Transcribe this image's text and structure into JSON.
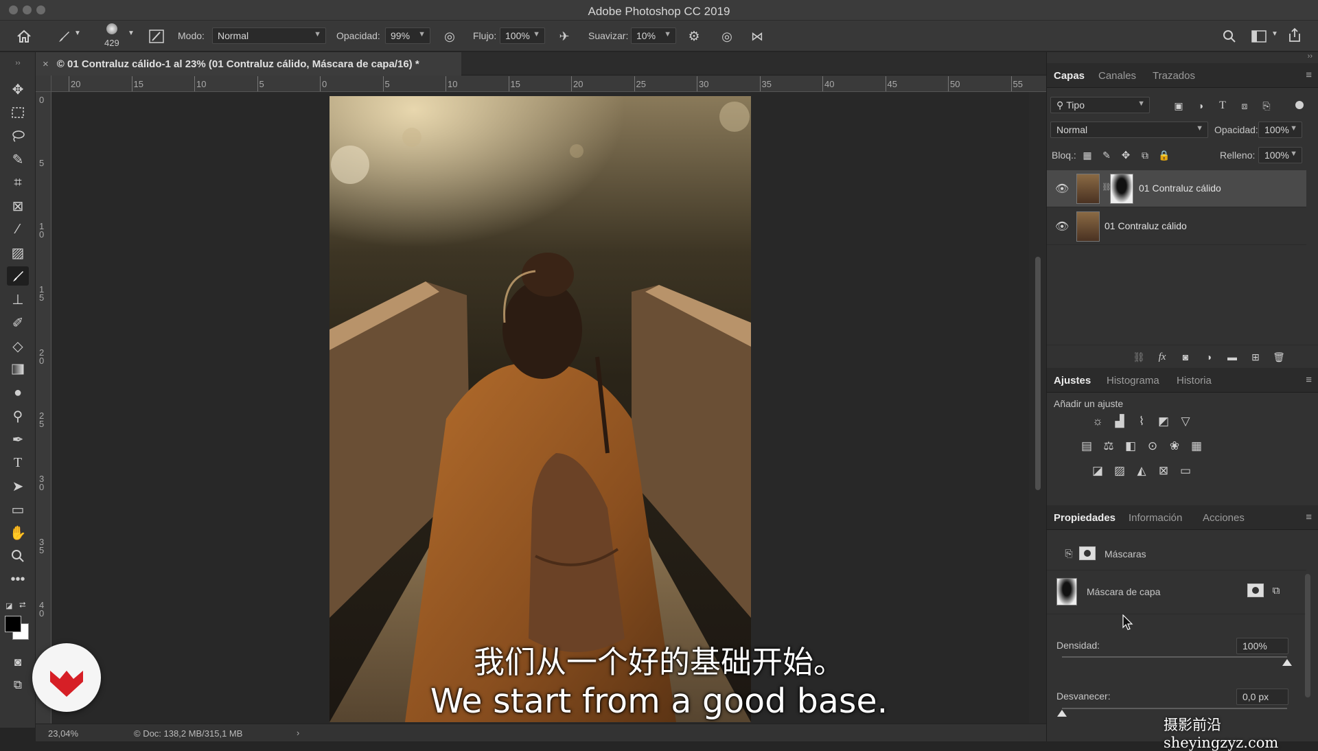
{
  "window": {
    "title": "Adobe Photoshop CC 2019"
  },
  "options_bar": {
    "brush_size": "429",
    "mode_label": "Modo:",
    "mode_value": "Normal",
    "opacity_label": "Opacidad:",
    "opacity_value": "99%",
    "flow_label": "Flujo:",
    "flow_value": "100%",
    "smoothing_label": "Suavizar:",
    "smoothing_value": "10%"
  },
  "document": {
    "tab_title": "© 01 Contraluz cálido-1 al 23% (01 Contraluz cálido, Máscara de capa/16) *",
    "ruler_h_ticks": [
      "20",
      "15",
      "10",
      "5",
      "0",
      "5",
      "10",
      "15",
      "20",
      "25",
      "30",
      "35",
      "40",
      "45",
      "50",
      "55"
    ],
    "ruler_v_ticks": [
      "0",
      "5",
      "1 0",
      "1 5",
      "2 0",
      "2 5",
      "3 0",
      "3 5",
      "4 0",
      "5"
    ]
  },
  "status_bar": {
    "zoom": "23,04%",
    "doc_info": "© Doc: 138,2 MB/315,1 MB"
  },
  "layers_panel": {
    "tabs": [
      "Capas",
      "Canales",
      "Trazados"
    ],
    "filter_value": "Tipo",
    "blend_mode": "Normal",
    "opacity_label": "Opacidad:",
    "opacity_value": "100%",
    "lock_label": "Bloq.:",
    "fill_label": "Relleno:",
    "fill_value": "100%",
    "layers": [
      {
        "name": "01 Contraluz cálido",
        "has_mask": true,
        "selected": true
      },
      {
        "name": "01 Contraluz cálido",
        "has_mask": false,
        "selected": false
      }
    ]
  },
  "adjustments_panel": {
    "tabs": [
      "Ajustes",
      "Histograma",
      "Historia"
    ],
    "add_label": "Añadir un ajuste"
  },
  "properties_panel": {
    "tabs": [
      "Propiedades",
      "Información",
      "Acciones"
    ],
    "section_title": "Máscaras",
    "mask_label": "Máscara de capa",
    "density_label": "Densidad:",
    "density_value": "100%",
    "density_level": 1.0,
    "feather_label": "Desvanecer:",
    "feather_value": "0,0 px",
    "feather_level": 0.0
  },
  "overlay": {
    "subtitle_zh": "我们从一个好的基础开始。",
    "subtitle_en": "We start from a good base.",
    "watermark": "摄影前沿sheyingzyz.com"
  },
  "colors": {
    "accent_red": "#d61f26",
    "panel_bg": "#323232",
    "canvas_bg": "#282828"
  }
}
